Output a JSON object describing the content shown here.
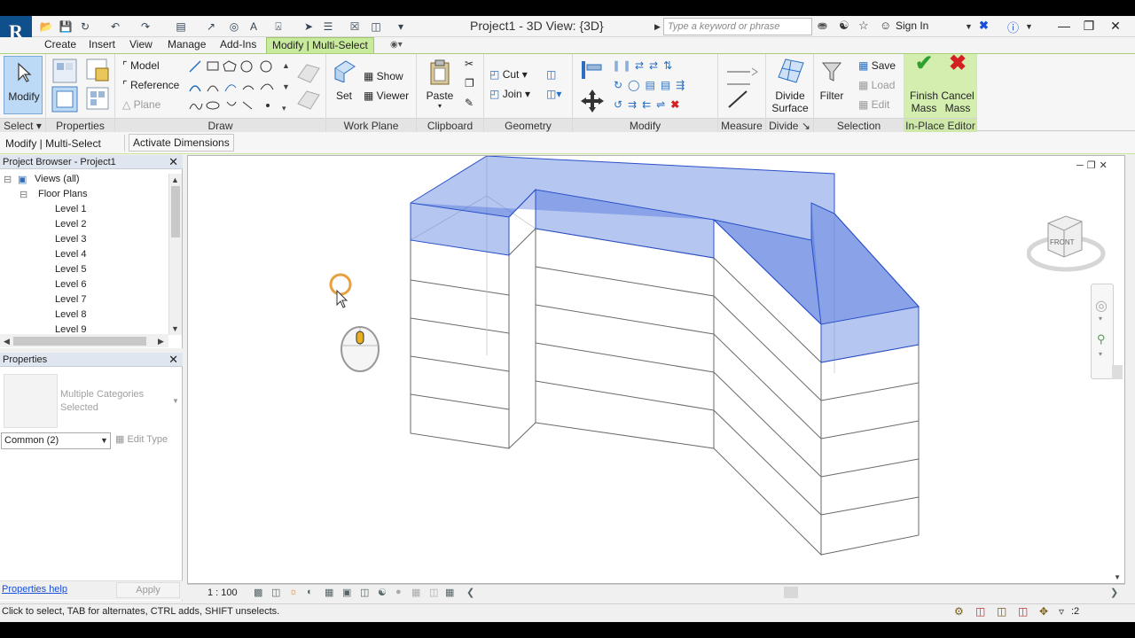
{
  "titlebar": {
    "title": "Project1 - 3D View: {3D}",
    "search_placeholder": "Type a keyword or phrase",
    "sign_in": "Sign In",
    "app_letter": "R"
  },
  "tabs": [
    {
      "label": "Create"
    },
    {
      "label": "Insert"
    },
    {
      "label": "View"
    },
    {
      "label": "Manage"
    },
    {
      "label": "Add-Ins"
    },
    {
      "label": "Modify | Multi-Select"
    }
  ],
  "ribbon": {
    "select": {
      "title": "Select",
      "modify": "Modify"
    },
    "properties": {
      "title": "Properties"
    },
    "draw": {
      "title": "Draw",
      "model": "Model",
      "reference": "Reference",
      "plane": "Plane"
    },
    "work_plane": {
      "title": "Work Plane",
      "set": "Set",
      "show": "Show",
      "viewer": "Viewer"
    },
    "clipboard": {
      "title": "Clipboard",
      "paste": "Paste"
    },
    "geometry": {
      "title": "Geometry",
      "cut": "Cut",
      "join": "Join"
    },
    "modify": {
      "title": "Modify"
    },
    "measure": {
      "title": "Measure"
    },
    "divide": {
      "title": "Divide",
      "label1": "Divide",
      "label2": "Surface"
    },
    "selection": {
      "title": "Selection",
      "filter": "Filter",
      "save": "Save",
      "load": "Load",
      "edit": "Edit"
    },
    "in_place": {
      "title": "In-Place Editor",
      "finish1": "Finish",
      "finish2": "Mass",
      "cancel1": "Cancel",
      "cancel2": "Mass"
    }
  },
  "options_bar": {
    "context": "Modify | Multi-Select",
    "activate_dimensions": "Activate Dimensions"
  },
  "project_browser": {
    "title": "Project Browser - Project1",
    "views_all": "Views (all)",
    "floor_plans": "Floor Plans",
    "levels": [
      "Level 1",
      "Level 2",
      "Level 3",
      "Level 4",
      "Level 5",
      "Level 6",
      "Level 7",
      "Level 8",
      "Level 9"
    ]
  },
  "properties": {
    "title": "Properties",
    "type_name": "Multiple Categories Selected",
    "filter": "Common (2)",
    "edit_type": "Edit Type",
    "help": "Properties help",
    "apply": "Apply"
  },
  "view_controls": {
    "scale": "1 : 100"
  },
  "viewcube": {
    "face": "FRONT"
  },
  "status": {
    "text": "Click to select, TAB for alternates, CTRL adds, SHIFT unselects.",
    "filter_count": ":2"
  },
  "colors": {
    "ribbon_accent": "#c8ea9c",
    "selection_fill": "#5a82e0",
    "app_button": "#0e4f8c"
  }
}
